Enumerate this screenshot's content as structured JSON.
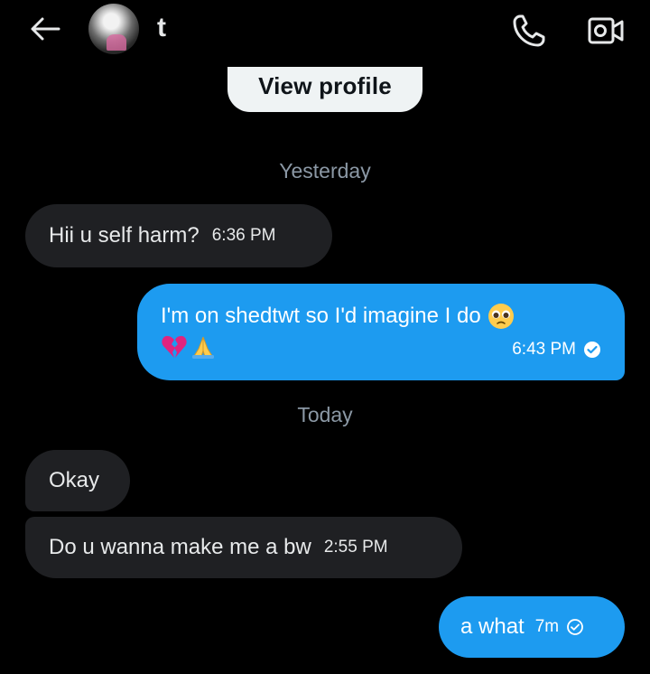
{
  "header": {
    "contact_name": "t",
    "icons": [
      "back-arrow-icon",
      "phone-icon",
      "video-camera-icon"
    ]
  },
  "view_profile": {
    "label": "View profile"
  },
  "separators": {
    "yesterday": "Yesterday",
    "today": "Today"
  },
  "messages": [
    {
      "direction": "received",
      "text": "Hii u self harm?",
      "time": "6:36 PM"
    },
    {
      "direction": "sent",
      "text": "I'm on shedtwt so I'd imagine I do",
      "emojis": [
        "pleading-face",
        "broken-heart",
        "folded-hands"
      ],
      "time": "6:43 PM",
      "status": "read"
    },
    {
      "direction": "received",
      "text": "Okay",
      "time": ""
    },
    {
      "direction": "received",
      "text": "Do u wanna make me a bw",
      "time": "2:55 PM"
    },
    {
      "direction": "sent",
      "text": "a what",
      "time": "7m",
      "status": "sent"
    }
  ],
  "colors": {
    "background": "#000000",
    "received_bubble": "#1f2023",
    "sent_bubble": "#1d9bf0",
    "muted_text": "#8b98a5"
  }
}
